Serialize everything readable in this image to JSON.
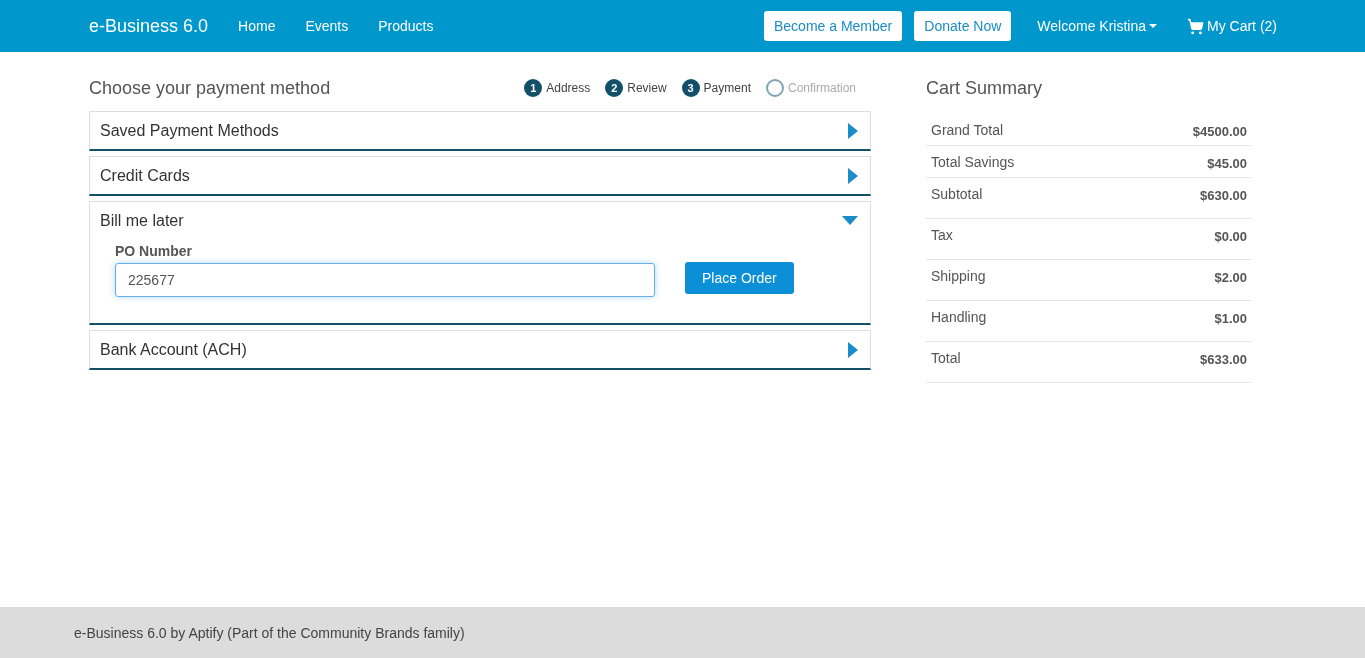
{
  "navbar": {
    "brand": "e-Business 6.0",
    "links": [
      "Home",
      "Events",
      "Products"
    ],
    "buttons": [
      "Become a Member",
      "Donate Now"
    ],
    "user_menu": "Welcome Kristina",
    "cart": "My Cart (2)"
  },
  "payment": {
    "title": "Choose your payment method",
    "steps": [
      {
        "number": "1",
        "label": "Address",
        "done": true
      },
      {
        "number": "2",
        "label": "Review",
        "done": true
      },
      {
        "number": "3",
        "label": "Payment",
        "done": true
      },
      {
        "label": "Confirmation",
        "done": false
      }
    ],
    "panels": [
      {
        "title": "Saved Payment Methods",
        "expanded": false
      },
      {
        "title": "Credit Cards",
        "expanded": false
      },
      {
        "title": "Bill me later",
        "expanded": true,
        "field_label": "PO Number",
        "field_value": "225677",
        "button": "Place Order"
      },
      {
        "title": "Bank Account (ACH)",
        "expanded": false
      }
    ]
  },
  "cart_summary": {
    "title": "Cart Summary",
    "rows": [
      {
        "label": "Grand Total",
        "value": "$4500.00"
      },
      {
        "label": "Total Savings",
        "value": "$45.00"
      },
      {
        "label": "Subtotal",
        "value": "$630.00"
      },
      {
        "label": "Tax",
        "value": "$0.00"
      },
      {
        "label": "Shipping",
        "value": "$2.00"
      },
      {
        "label": "Handling",
        "value": "$1.00"
      },
      {
        "label": "Total",
        "value": "$633.00"
      }
    ]
  },
  "footer": "e-Business 6.0 by Aptify (Part of the Community Brands family)"
}
